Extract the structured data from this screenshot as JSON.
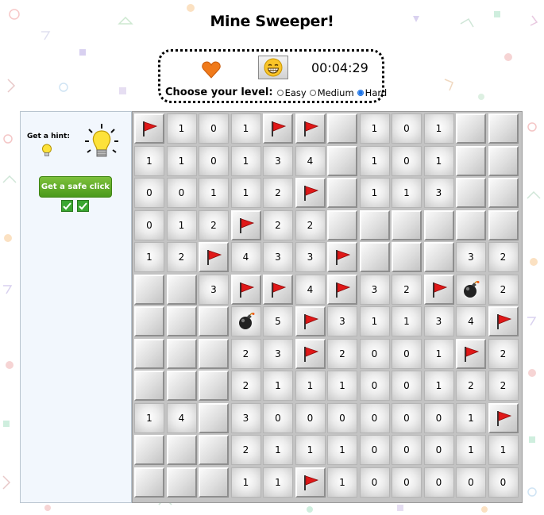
{
  "title": "Mine Sweeper!",
  "status": {
    "lives_icon": "heart-icon",
    "smiley_icon": "grinning-face-icon",
    "timer": "00:04:29"
  },
  "level": {
    "label": "Choose your level:",
    "options": [
      "Easy",
      "Medium",
      "Hard"
    ],
    "selected": "Hard"
  },
  "hints": {
    "label": "Get a hint:",
    "safe_click_label": "Get a safe click",
    "safe_clicks_remaining": 2
  },
  "board": {
    "rows": 12,
    "cols": 12,
    "legend": "H = hidden cell, F = flagged cell, M = mine, number/text = revealed cell value",
    "cells": [
      [
        "F",
        "1",
        "0",
        "1",
        "F",
        "F",
        "H",
        "1",
        "0",
        "1",
        "H",
        "H"
      ],
      [
        "1",
        "1",
        "0",
        "1",
        "3",
        "4",
        "H",
        "1",
        "0",
        "1",
        "H",
        "H"
      ],
      [
        "0",
        "0",
        "1",
        "1",
        "2",
        "F",
        "H",
        "1",
        "1",
        "3",
        "H",
        "H"
      ],
      [
        "0",
        "1",
        "2",
        "F",
        "2",
        "2",
        "H",
        "H",
        "H",
        "H",
        "H",
        "H"
      ],
      [
        "1",
        "2",
        "F",
        "4",
        "3",
        "3",
        "F",
        "H",
        "H",
        "H",
        "3",
        "2"
      ],
      [
        "H",
        "H",
        "3",
        "F",
        "F",
        "4",
        "F",
        "3",
        "2",
        "F",
        "M",
        "2"
      ],
      [
        "H",
        "H",
        "H",
        "M",
        "5",
        "F",
        "3",
        "1",
        "1",
        "3",
        "4",
        "F"
      ],
      [
        "H",
        "H",
        "H",
        "2",
        "3",
        "F",
        "2",
        "0",
        "0",
        "1",
        "F",
        "2"
      ],
      [
        "H",
        "H",
        "H",
        "2",
        "1",
        "1",
        "1",
        "0",
        "0",
        "1",
        "2",
        "2"
      ],
      [
        "1",
        "4",
        "H",
        "3",
        "0",
        "0",
        "0",
        "0",
        "0",
        "0",
        "1",
        "F"
      ],
      [
        "H",
        "H",
        "H",
        "2",
        "1",
        "1",
        "1",
        "0",
        "0",
        "0",
        "1",
        "1"
      ],
      [
        "H",
        "H",
        "H",
        "1",
        "1",
        "F",
        "1",
        "0",
        "0",
        "0",
        "0",
        "0"
      ]
    ]
  },
  "colors": {
    "flag": "#e01818",
    "heart": "#f07a1a",
    "bulb": "#fde23a",
    "safe_button": "#5aa820"
  }
}
